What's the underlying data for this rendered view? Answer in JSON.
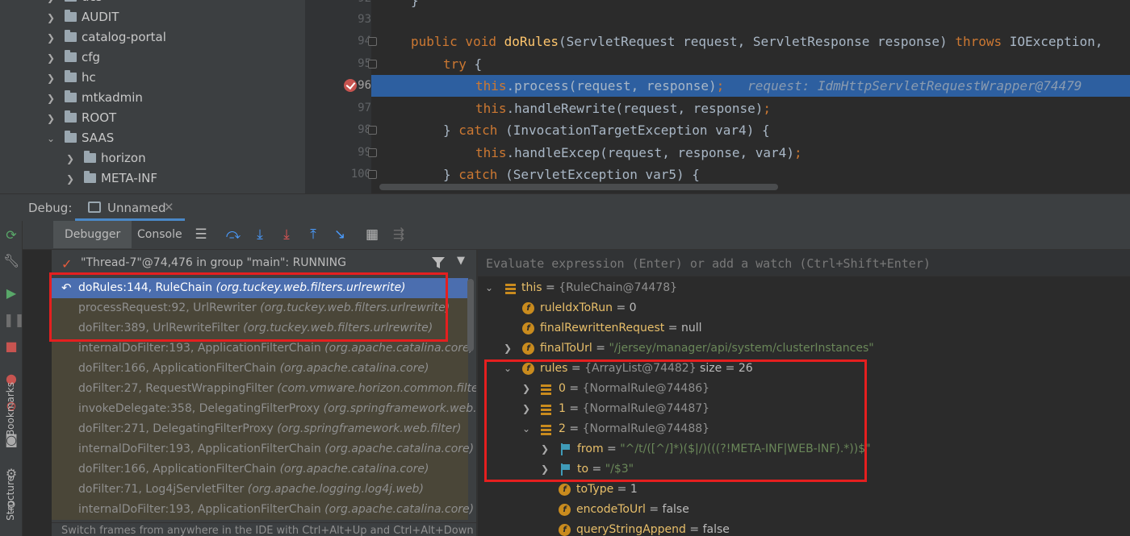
{
  "project_tree": {
    "items": [
      {
        "label": "ucs",
        "expanded": false
      },
      {
        "label": "AUDIT",
        "expanded": false
      },
      {
        "label": "catalog-portal",
        "expanded": false
      },
      {
        "label": "cfg",
        "expanded": false
      },
      {
        "label": "hc",
        "expanded": false
      },
      {
        "label": "mtkadmin",
        "expanded": false
      },
      {
        "label": "ROOT",
        "expanded": false
      },
      {
        "label": "SAAS",
        "expanded": true
      },
      {
        "label": "horizon",
        "expanded": false
      },
      {
        "label": "META-INF",
        "expanded": false
      }
    ]
  },
  "editor": {
    "line_numbers": [
      "92",
      "93",
      "94",
      "95",
      "96",
      "97",
      "98",
      "99",
      "100"
    ],
    "lines": {
      "l92": "}",
      "l94_kw": "public void ",
      "l94_fn": "doRules",
      "l94_rest": "(ServletRequest request, ServletResponse response) ",
      "l94_throws": "throws",
      "l94_tail": " IOException,",
      "l95_kw": "try",
      "l95_rest": " {",
      "l96_this": "this",
      "l96_rest": ".process(request, response)",
      "l96_semi": ";",
      "l96_hint": "request: IdmHttpServletRequestWrapper@74479",
      "l97_this": "this",
      "l97_rest": ".handleRewrite(request, response)",
      "l97_semi": ";",
      "l98_pre": "} ",
      "l98_kw": "catch",
      "l98_rest": " (InvocationTargetException var4) {",
      "l99_this": "this",
      "l99_rest": ".handleExcep(request, response, var4)",
      "l99_semi": ";",
      "l100_pre": "} ",
      "l100_kw": "catch",
      "l100_rest": " (ServletException var5) {"
    }
  },
  "debug": {
    "label": "Debug:",
    "session_tab": "Unnamed",
    "tabs": {
      "debugger": "Debugger",
      "console": "Console"
    },
    "thread": "\"Thread-7\"@74,476 in group \"main\": RUNNING",
    "frames": [
      {
        "method": "doRules:144, RuleChain",
        "pkg": "(org.tuckey.web.filters.urlrewrite)"
      },
      {
        "method": "processRequest:92, UrlRewriter",
        "pkg": "(org.tuckey.web.filters.urlrewrite)"
      },
      {
        "method": "doFilter:389, UrlRewriteFilter",
        "pkg": "(org.tuckey.web.filters.urlrewrite)"
      },
      {
        "method": "internalDoFilter:193, ApplicationFilterChain",
        "pkg": "(org.apache.catalina.core)"
      },
      {
        "method": "doFilter:166, ApplicationFilterChain",
        "pkg": "(org.apache.catalina.core)"
      },
      {
        "method": "doFilter:27, RequestWrappingFilter",
        "pkg": "(com.vmware.horizon.common.filter)"
      },
      {
        "method": "invokeDelegate:358, DelegatingFilterProxy",
        "pkg": "(org.springframework.web.filter)"
      },
      {
        "method": "doFilter:271, DelegatingFilterProxy",
        "pkg": "(org.springframework.web.filter)"
      },
      {
        "method": "internalDoFilter:193, ApplicationFilterChain",
        "pkg": "(org.apache.catalina.core)"
      },
      {
        "method": "doFilter:166, ApplicationFilterChain",
        "pkg": "(org.apache.catalina.core)"
      },
      {
        "method": "doFilter:71, Log4jServletFilter",
        "pkg": "(org.apache.logging.log4j.web)"
      },
      {
        "method": "internalDoFilter:193, ApplicationFilterChain",
        "pkg": "(org.apache.catalina.core)"
      }
    ],
    "hint": "Switch frames from anywhere in the IDE with Ctrl+Alt+Up and Ctrl+Alt+Down",
    "eval_placeholder": "Evaluate expression (Enter) or add a watch (Ctrl+Shift+Enter)",
    "variables": [
      {
        "name": "this",
        "eq": " = ",
        "value": "{RuleChain@74478}",
        "vclass": "vtype"
      },
      {
        "name": "ruleIdxToRun",
        "eq": " = ",
        "value": "0",
        "vclass": "vnum"
      },
      {
        "name": "finalRewrittenRequest",
        "eq": " = ",
        "value": "null",
        "vclass": "vnum"
      },
      {
        "name": "finalToUrl",
        "eq": " = ",
        "value": "\"/jersey/manager/api/system/clusterInstances\"",
        "vclass": "vstr"
      },
      {
        "name": "rules",
        "eq": " = ",
        "value": "{ArrayList@74482}",
        "vclass": "vtype",
        "extra": "  size = 26"
      },
      {
        "name": "0",
        "eq": " = ",
        "value": "{NormalRule@74486}",
        "vclass": "vtype"
      },
      {
        "name": "1",
        "eq": " = ",
        "value": "{NormalRule@74487}",
        "vclass": "vtype"
      },
      {
        "name": "2",
        "eq": " = ",
        "value": "{NormalRule@74488}",
        "vclass": "vtype"
      },
      {
        "name": "from",
        "eq": " = ",
        "value": "\"^/t/([^/]*)($|/)(((?!META-INF|WEB-INF).*))$\"",
        "vclass": "vstr"
      },
      {
        "name": "to",
        "eq": " = ",
        "value": "\"/$3\"",
        "vclass": "vstr"
      },
      {
        "name": "toType",
        "eq": " = ",
        "value": "1",
        "vclass": "vnum"
      },
      {
        "name": "encodeToUrl",
        "eq": " = ",
        "value": "false",
        "vclass": "vnum"
      },
      {
        "name": "queryStringAppend",
        "eq": " = ",
        "value": "false",
        "vclass": "vnum"
      }
    ]
  },
  "side_labels": {
    "bookmarks": "Bookmarks",
    "structure": "Structure"
  },
  "colors": {
    "accent": "#4a88c7",
    "selection": "#4b6eaf",
    "exec_line": "#2d5fa0",
    "annotation": "#e51f1f"
  }
}
